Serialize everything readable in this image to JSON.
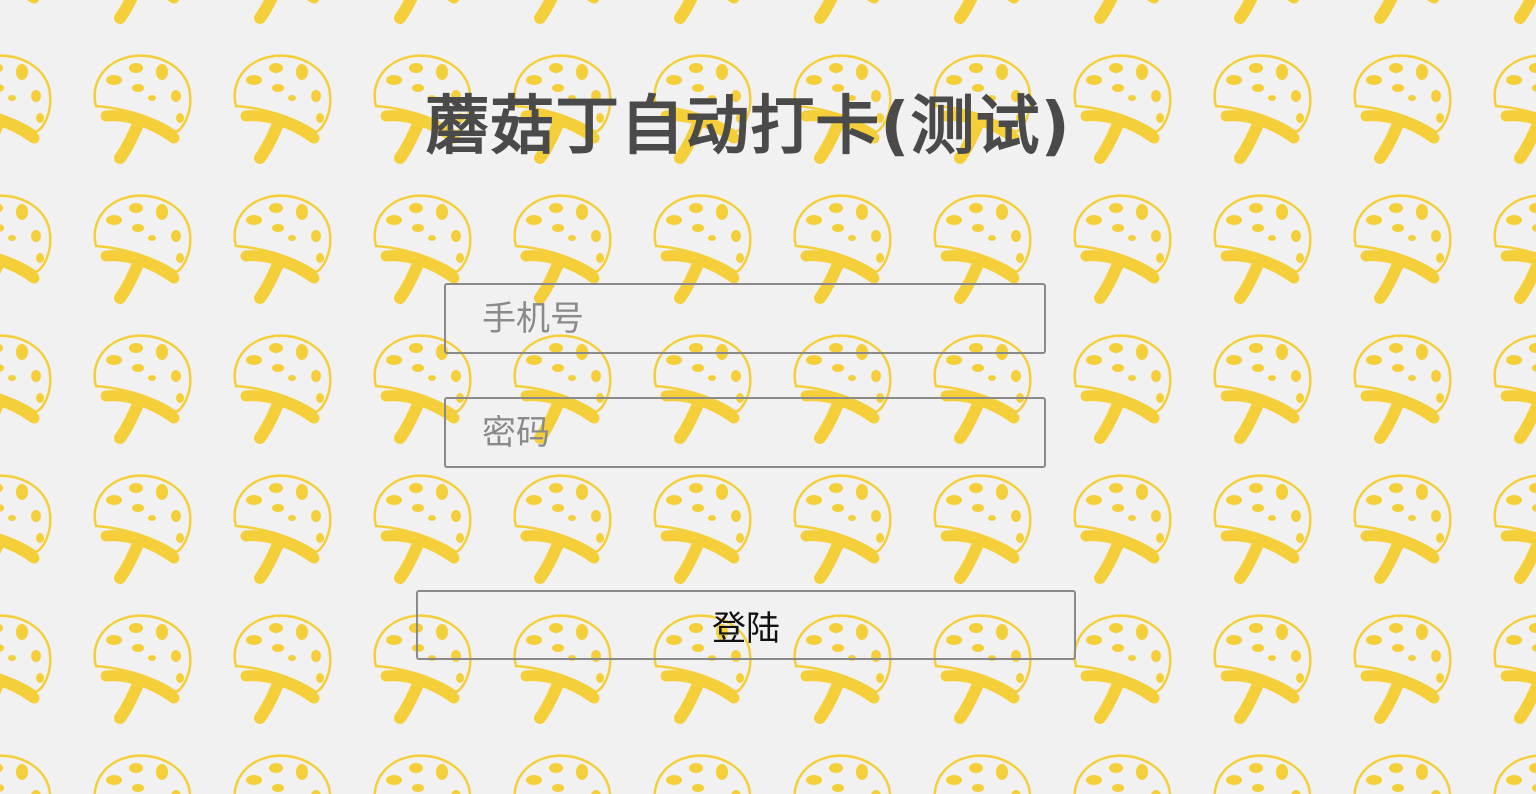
{
  "page": {
    "title": "蘑菇丁自动打卡(测试)",
    "background_color": "#f1f1f1",
    "pattern_icon": "mushroom-icon",
    "pattern_color": "#f5cf3a"
  },
  "form": {
    "phone_placeholder": "手机号",
    "phone_value": "",
    "password_placeholder": "密码",
    "password_value": "",
    "login_label": "登陆"
  }
}
